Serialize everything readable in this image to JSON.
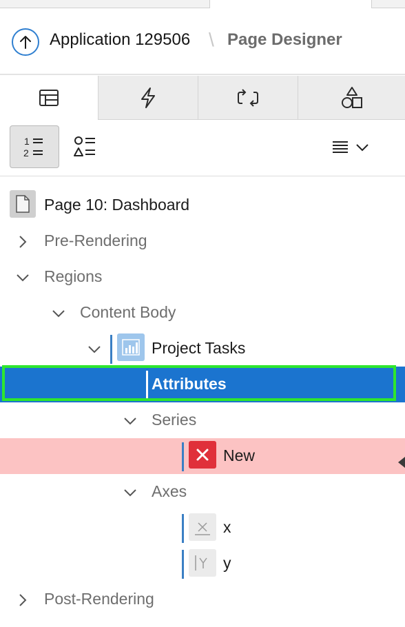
{
  "header": {
    "app_title": "Application 129506",
    "separator": "\\",
    "page_designer": "Page Designer"
  },
  "tabs": [
    {
      "icon": "rendering-tree-icon",
      "active": true
    },
    {
      "icon": "dynamic-actions-icon",
      "active": false
    },
    {
      "icon": "processing-icon",
      "active": false
    },
    {
      "icon": "shared-components-icon",
      "active": false
    }
  ],
  "toolbar": {
    "icons": [
      "ordered-list-icon",
      "component-list-icon",
      "menu-icon",
      "chevron-down-icon"
    ]
  },
  "tree": {
    "page": "Page 10: Dashboard",
    "pre_rendering": "Pre-Rendering",
    "regions": "Regions",
    "content_body": "Content Body",
    "project_tasks": "Project Tasks",
    "attributes": "Attributes",
    "series": "Series",
    "new": "New",
    "axes": "Axes",
    "x": "x",
    "y": "y",
    "post_rendering": "Post-Rendering"
  },
  "colors": {
    "accent": "#2f7fd0",
    "selected_row": "#1b74cf",
    "error_row": "#fcc3c3",
    "error_badge": "#e0303a",
    "focus_outline": "#2ee62e"
  }
}
